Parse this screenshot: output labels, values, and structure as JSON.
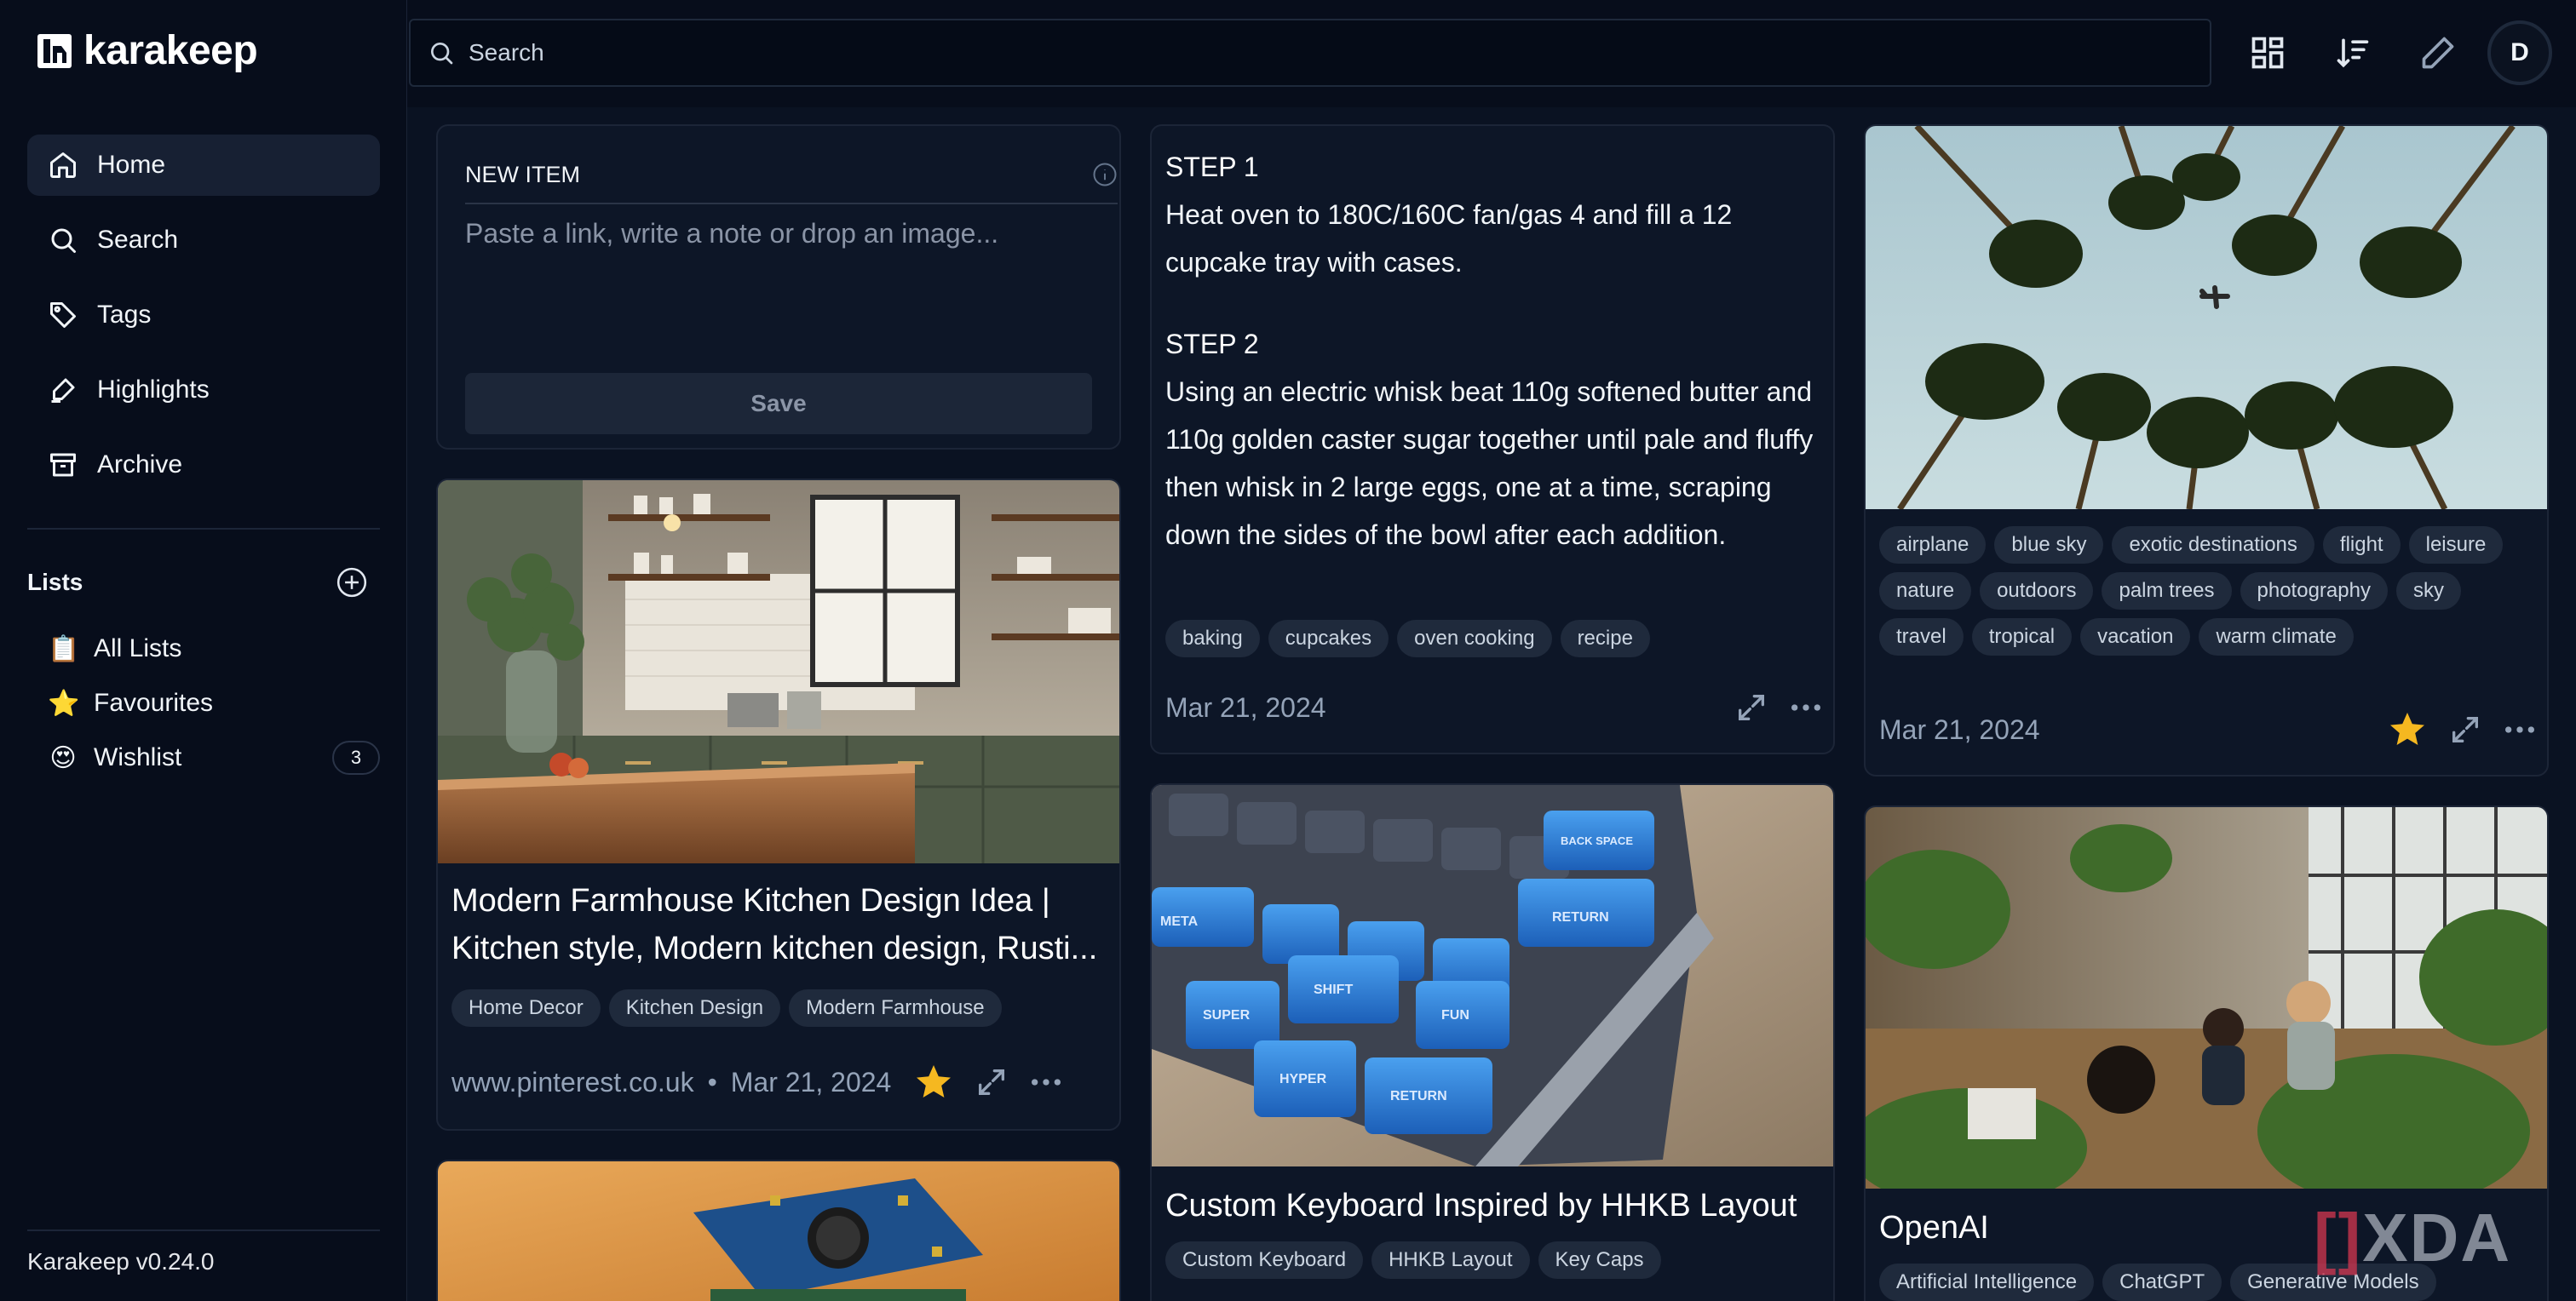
{
  "app": {
    "name": "karakeep",
    "version": "Karakeep v0.24.0"
  },
  "nav": [
    {
      "label": "Home",
      "icon": "home-icon"
    },
    {
      "label": "Search",
      "icon": "search-icon"
    },
    {
      "label": "Tags",
      "icon": "tag-icon"
    },
    {
      "label": "Highlights",
      "icon": "highlighter-icon"
    },
    {
      "label": "Archive",
      "icon": "archive-icon"
    }
  ],
  "lists": {
    "title": "Lists",
    "items": [
      {
        "emoji": "📋",
        "label": "All Lists"
      },
      {
        "emoji": "⭐",
        "label": "Favourites"
      },
      {
        "emoji": "😍",
        "label": "Wishlist",
        "count": "3"
      }
    ]
  },
  "search": {
    "placeholder": "Search"
  },
  "user": {
    "initial": "D"
  },
  "new_item": {
    "title": "NEW ITEM",
    "placeholder": "Paste a link, write a note or drop an image...",
    "save_label": "Save"
  },
  "cards": {
    "kitchen": {
      "title": "Modern Farmhouse Kitchen Design Idea | Kitchen style, Modern kitchen design, Rusti...",
      "tags": [
        "Home Decor",
        "Kitchen Design",
        "Modern Farmhouse"
      ],
      "source": "www.pinterest.co.uk",
      "date": "Mar 21, 2024",
      "starred": true
    },
    "recipe": {
      "step1_heading": "STEP 1",
      "step1_text": "Heat oven to 180C/160C fan/gas 4 and fill a 12 cupcake tray with cases.",
      "step2_heading": "STEP 2",
      "step2_text": "Using an electric whisk beat 110g softened butter and 110g golden caster sugar together until pale and fluffy then whisk in 2 large eggs, one at a time, scraping down the sides of the bowl after each addition.",
      "tags": [
        "baking",
        "cupcakes",
        "oven cooking",
        "recipe"
      ],
      "date": "Mar 21, 2024"
    },
    "palms": {
      "tags": [
        "airplane",
        "blue sky",
        "exotic destinations",
        "flight",
        "leisure",
        "nature",
        "outdoors",
        "palm trees",
        "photography",
        "sky",
        "travel",
        "tropical",
        "vacation",
        "warm climate"
      ],
      "date": "Mar 21, 2024",
      "starred": true
    },
    "keyboard": {
      "title": "Custom Keyboard Inspired by HHKB Layout",
      "tags": [
        "Custom Keyboard",
        "HHKB Layout",
        "Key Caps"
      ],
      "keycap_labels": [
        "RETURN",
        "SHIFT",
        "FUN",
        "HYPER",
        "SUPER",
        "META",
        "RETURN",
        "BACK SPACE"
      ]
    },
    "openai": {
      "title": "OpenAI",
      "tags": [
        "Artificial Intelligence",
        "ChatGPT",
        "Generative Models"
      ]
    }
  },
  "watermark": {
    "bracket": "[]",
    "text": "XDA"
  },
  "colors": {
    "background": "#0a1222",
    "sidebar": "#070d1b",
    "card": "#0d1627",
    "tag": "#1f2a3c",
    "star": "#f5b820"
  }
}
